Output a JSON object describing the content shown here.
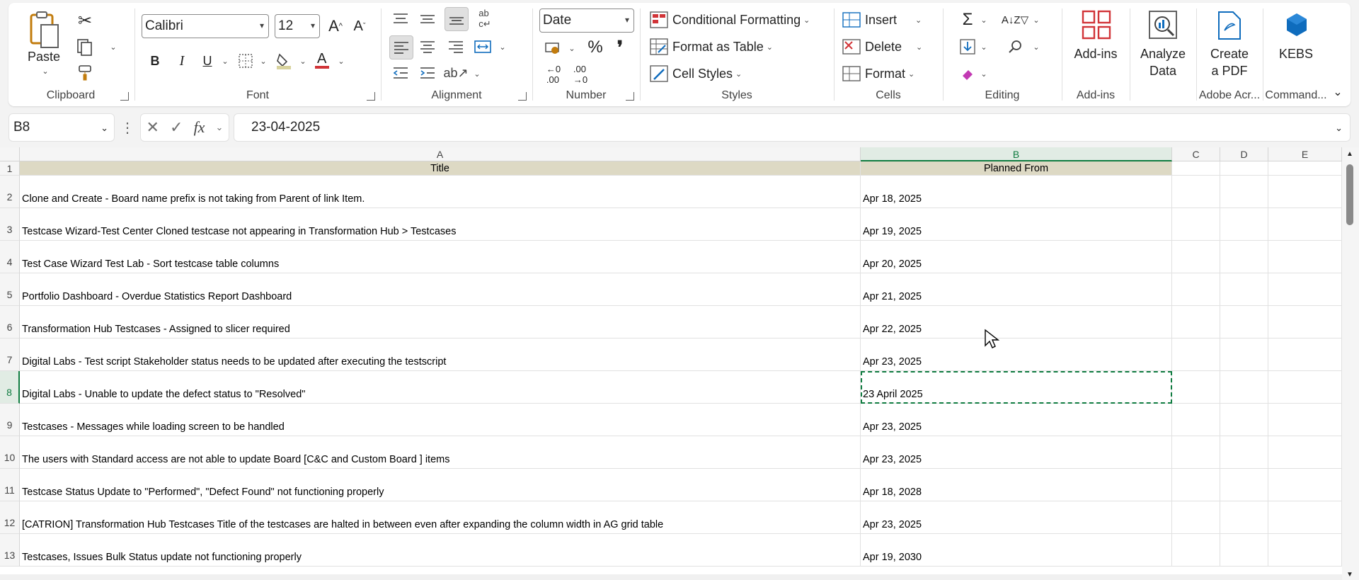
{
  "ribbon": {
    "clipboard": {
      "label": "Clipboard",
      "paste": "Paste"
    },
    "font": {
      "label": "Font",
      "family": "Calibri",
      "size": "12",
      "bold": "B",
      "italic": "I",
      "underline": "U"
    },
    "alignment": {
      "label": "Alignment"
    },
    "number": {
      "label": "Number",
      "format": "Date",
      "percent": "%",
      "comma": "❜"
    },
    "styles": {
      "label": "Styles",
      "conditional": "Conditional Formatting",
      "format_table": "Format as Table",
      "cell_styles": "Cell Styles"
    },
    "cells": {
      "label": "Cells",
      "insert": "Insert",
      "delete": "Delete",
      "format": "Format"
    },
    "editing": {
      "label": "Editing"
    },
    "addins": {
      "label": "Add-ins",
      "button": "Add-ins"
    },
    "analyze": {
      "line1": "Analyze",
      "line2": "Data"
    },
    "pdf": {
      "line1": "Create",
      "line2": "a PDF",
      "group": "Adobe Acr..."
    },
    "kebs": {
      "button": "KEBS",
      "group": "Command..."
    },
    "colors": {
      "accent_green": "#107c41",
      "icon_red": "#d13438",
      "icon_blue": "#0f6cbd"
    }
  },
  "formula_bar": {
    "name_box": "B8",
    "fx": "fx",
    "value": "23-04-2025"
  },
  "columns": [
    "A",
    "B",
    "C",
    "D",
    "E"
  ],
  "selected_cell": {
    "col": "B",
    "row": "8"
  },
  "rows": [
    {
      "num": "1",
      "a": "Title",
      "b": "Planned From"
    },
    {
      "num": "2",
      "a": "Clone and Create - Board name prefix is not taking from Parent of link Item.",
      "b": "Apr 18, 2025"
    },
    {
      "num": "3",
      "a": "Testcase Wizard-Test Center Cloned testcase not appearing in Transformation Hub > Testcases",
      "b": "Apr 19, 2025"
    },
    {
      "num": "4",
      "a": "Test Case Wizard Test Lab - Sort testcase table columns",
      "b": "Apr 20, 2025"
    },
    {
      "num": "5",
      "a": "Portfolio Dashboard - Overdue Statistics Report Dashboard",
      "b": "Apr 21, 2025"
    },
    {
      "num": "6",
      "a": "Transformation Hub Testcases - Assigned to slicer required",
      "b": "Apr 22, 2025"
    },
    {
      "num": "7",
      "a": "Digital Labs - Test script Stakeholder status needs to be updated after executing the testscript",
      "b": "Apr 23, 2025"
    },
    {
      "num": "8",
      "a": "Digital Labs - Unable to update the defect status to \"Resolved\"",
      "b": "23 April 2025"
    },
    {
      "num": "9",
      "a": "Testcases - Messages while loading screen to be handled",
      "b": "Apr 23, 2025"
    },
    {
      "num": "10",
      "a": "The users with Standard access are not able to update Board [C&C and Custom Board ] items",
      "b": "Apr 23, 2025"
    },
    {
      "num": "11",
      "a": "Testcase Status Update to \"Performed\", \"Defect Found\" not functioning properly",
      "b": "Apr 18, 2028"
    },
    {
      "num": "12",
      "a": "[CATRION] Transformation Hub Testcases Title of the testcases are halted in between even after expanding the column width in AG grid table",
      "b": "Apr 23, 2025"
    },
    {
      "num": "13",
      "a": "Testcases, Issues Bulk Status update not functioning properly",
      "b": "Apr 19, 2030"
    }
  ]
}
